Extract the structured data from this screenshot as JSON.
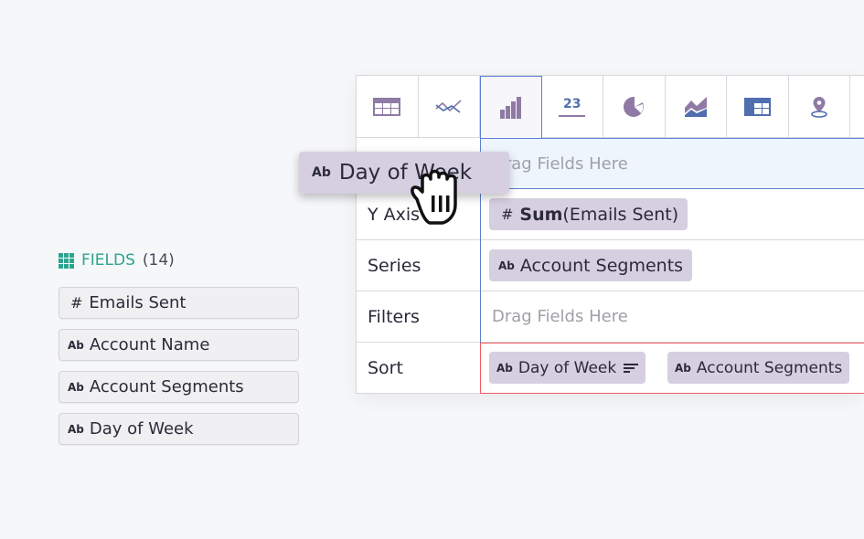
{
  "fields": {
    "title": "FIELDS",
    "count": "(14)",
    "items": [
      {
        "type": "#",
        "label": "Emails Sent"
      },
      {
        "type": "Ab",
        "label": "Account Name"
      },
      {
        "type": "Ab",
        "label": "Account Segments"
      },
      {
        "type": "Ab",
        "label": "Day of Week"
      }
    ]
  },
  "chart_types": [
    "table-icon",
    "line-chart-icon",
    "bar-chart-icon",
    "single-value-icon",
    "pie-chart-icon",
    "area-chart-icon",
    "pivot-table-icon",
    "map-pin-icon"
  ],
  "chart_type_selected": "bar-chart-icon",
  "single_value_label": "23",
  "rows": {
    "x_axis": {
      "placeholder": "Drag Fields Here"
    },
    "y_axis": {
      "label": "Y Axis",
      "chip_type": "#",
      "chip_agg": "Sum",
      "chip_field": "(Emails Sent)"
    },
    "series": {
      "label": "Series",
      "chip_type": "Ab",
      "chip_field": "Account Segments"
    },
    "filters": {
      "label": "Filters",
      "placeholder": "Drag Fields Here"
    },
    "sort": {
      "label": "Sort",
      "chips": [
        {
          "type": "Ab",
          "field": "Day of Week"
        },
        {
          "type": "Ab",
          "field": "Account Segments"
        }
      ]
    }
  },
  "dragging": {
    "type": "Ab",
    "label": "Day of Week"
  },
  "colors": {
    "accent": "#2aa68f",
    "chip": "#d6cfe0",
    "drop_border": "#5b7fd0",
    "sort_border": "#ee5a60",
    "icon_purple": "#8f7aa6",
    "icon_blue": "#4f6fae"
  }
}
